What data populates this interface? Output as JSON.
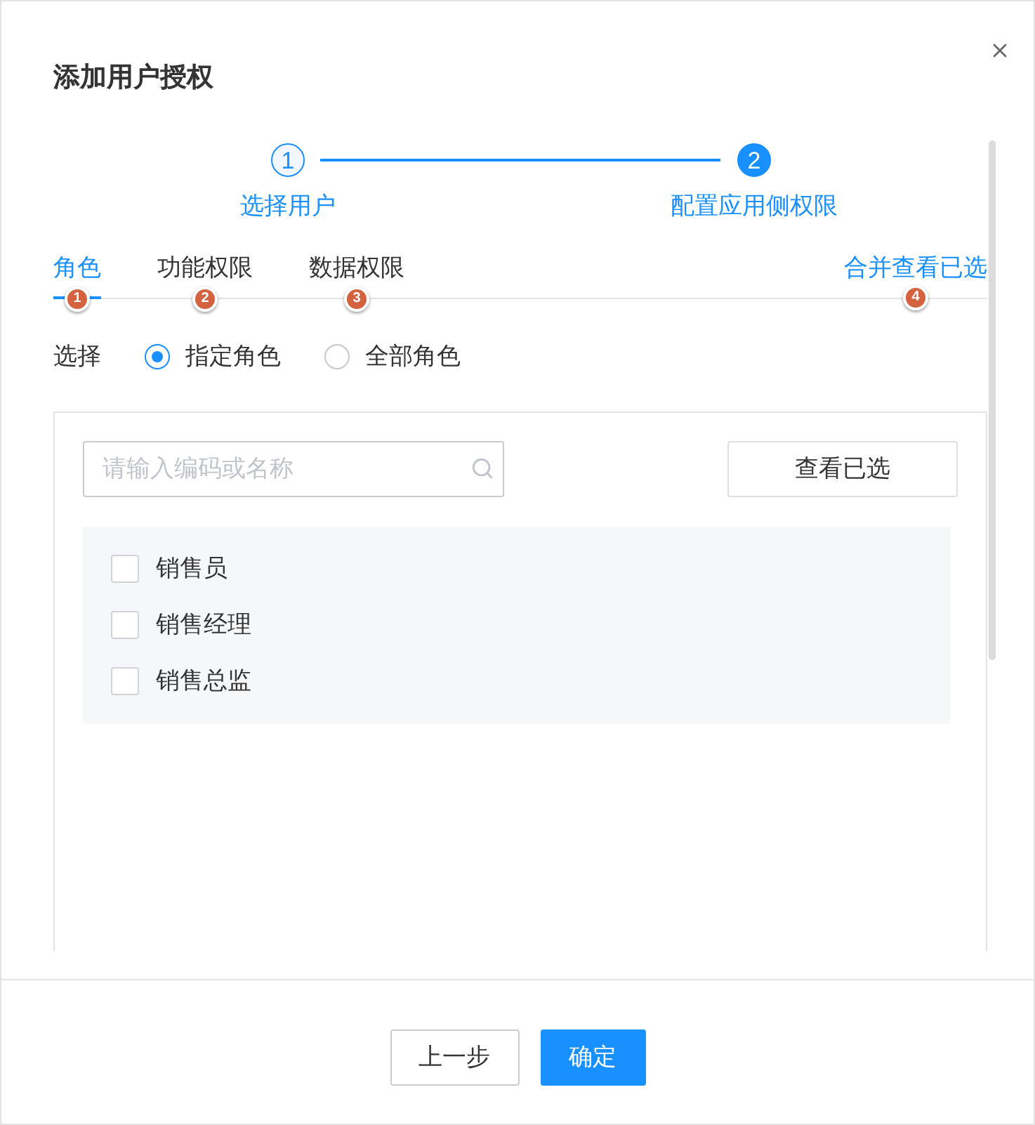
{
  "dialog": {
    "title": "添加用户授权"
  },
  "steps": [
    {
      "number": "1",
      "label": "选择用户",
      "current": false
    },
    {
      "number": "2",
      "label": "配置应用侧权限",
      "current": true
    }
  ],
  "tabs": [
    {
      "label": "角色",
      "selected": true,
      "marker": "1"
    },
    {
      "label": "功能权限",
      "selected": false,
      "marker": "2"
    },
    {
      "label": "数据权限",
      "selected": false,
      "marker": "3"
    }
  ],
  "merge_link": {
    "label": "合并查看已选",
    "marker": "4"
  },
  "scope": {
    "label": "选择",
    "options": [
      {
        "label": "指定角色",
        "selected": true
      },
      {
        "label": "全部角色",
        "selected": false
      }
    ]
  },
  "search": {
    "placeholder": "请输入编码或名称"
  },
  "view_selected_button": {
    "label": "查看已选"
  },
  "roles": [
    {
      "label": "销售员",
      "checked": false
    },
    {
      "label": "销售经理",
      "checked": false
    },
    {
      "label": "销售总监",
      "checked": false
    }
  ],
  "footer": {
    "buttons": [
      {
        "label": "上一步",
        "kind": "default"
      },
      {
        "label": "确定",
        "kind": "primary"
      }
    ]
  }
}
